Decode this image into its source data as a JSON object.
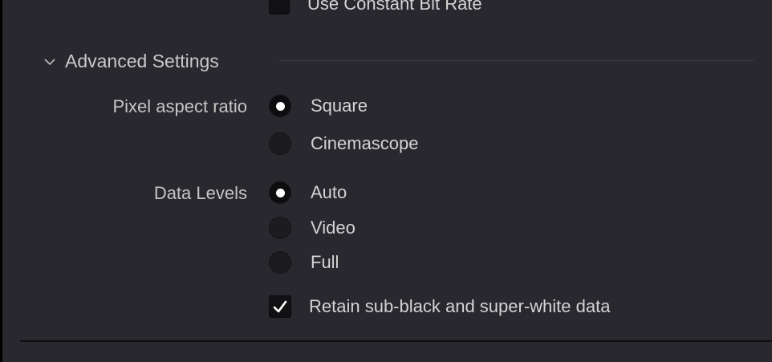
{
  "top_option": {
    "label": "Use Constant Bit Rate",
    "checked": false
  },
  "section": {
    "title": "Advanced Settings",
    "expanded": true,
    "chevron_icon": "chevron-down-icon"
  },
  "pixel_aspect_ratio": {
    "label": "Pixel aspect ratio",
    "options": [
      {
        "label": "Square",
        "selected": true
      },
      {
        "label": "Cinemascope",
        "selected": false
      }
    ]
  },
  "data_levels": {
    "label": "Data Levels",
    "options": [
      {
        "label": "Auto",
        "selected": true
      },
      {
        "label": "Video",
        "selected": false
      },
      {
        "label": "Full",
        "selected": false
      }
    ]
  },
  "retain_option": {
    "label": "Retain sub-black and super-white data",
    "checked": true
  },
  "colors": {
    "panel_bg": "#28282e",
    "text": "#d4d4d4",
    "radio_dot": "#ffffff"
  }
}
